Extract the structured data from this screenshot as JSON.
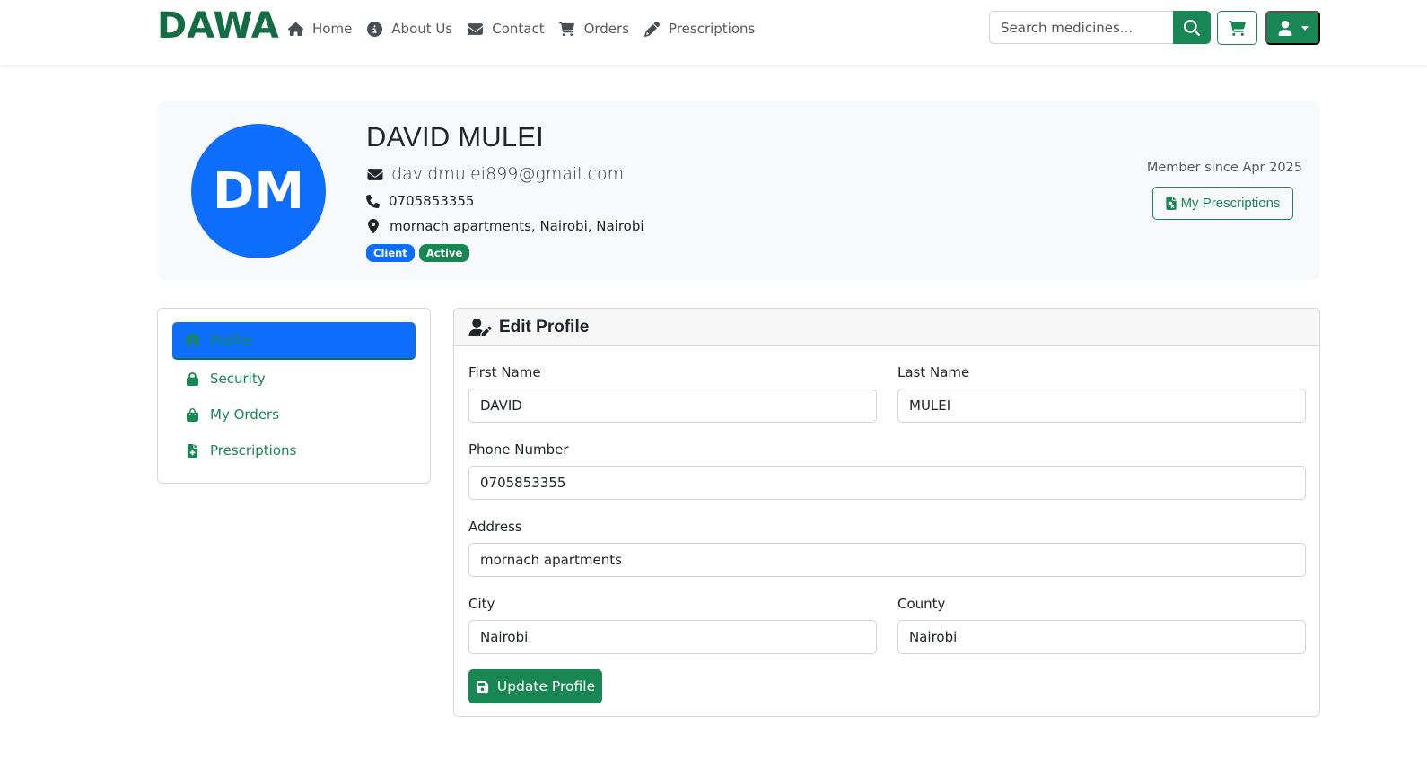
{
  "brand": "DAWA",
  "nav": {
    "links": [
      {
        "label": "Home",
        "icon": "home-icon"
      },
      {
        "label": "About Us",
        "icon": "info-icon"
      },
      {
        "label": "Contact",
        "icon": "envelope-icon"
      },
      {
        "label": "Orders",
        "icon": "cart-icon"
      },
      {
        "label": "Prescriptions",
        "icon": "pencil-icon"
      }
    ],
    "search_placeholder": "Search medicines..."
  },
  "profile": {
    "initials": "DM",
    "name": "DAVID MULEI",
    "email": "davidmulei899@gmail.com",
    "phone": "0705853355",
    "address": "mornach apartments, Nairobi, Nairobi",
    "badges": {
      "role": "Client",
      "status": "Active"
    },
    "member_since": "Member since Apr 2025",
    "prescriptions_button": "My Prescriptions"
  },
  "sidebar": {
    "items": [
      {
        "label": "Profile",
        "icon": "user-circle-icon",
        "active": true
      },
      {
        "label": "Security",
        "icon": "lock-icon"
      },
      {
        "label": "My Orders",
        "icon": "shopping-bag-icon"
      },
      {
        "label": "Prescriptions",
        "icon": "file-medical-icon"
      }
    ]
  },
  "edit_profile": {
    "title": "Edit Profile",
    "fields": {
      "first_name": {
        "label": "First Name",
        "value": "DAVID"
      },
      "last_name": {
        "label": "Last Name",
        "value": "MULEI"
      },
      "phone": {
        "label": "Phone Number",
        "value": "0705853355"
      },
      "address": {
        "label": "Address",
        "value": "mornach apartments"
      },
      "city": {
        "label": "City",
        "value": "Nairobi"
      },
      "county": {
        "label": "County",
        "value": "Nairobi"
      }
    },
    "submit_label": "Update Profile"
  },
  "colors": {
    "brand_green": "#146c43",
    "primary_green": "#198754",
    "primary_blue": "#0d6efd",
    "card_bg": "#f8f9fa"
  }
}
